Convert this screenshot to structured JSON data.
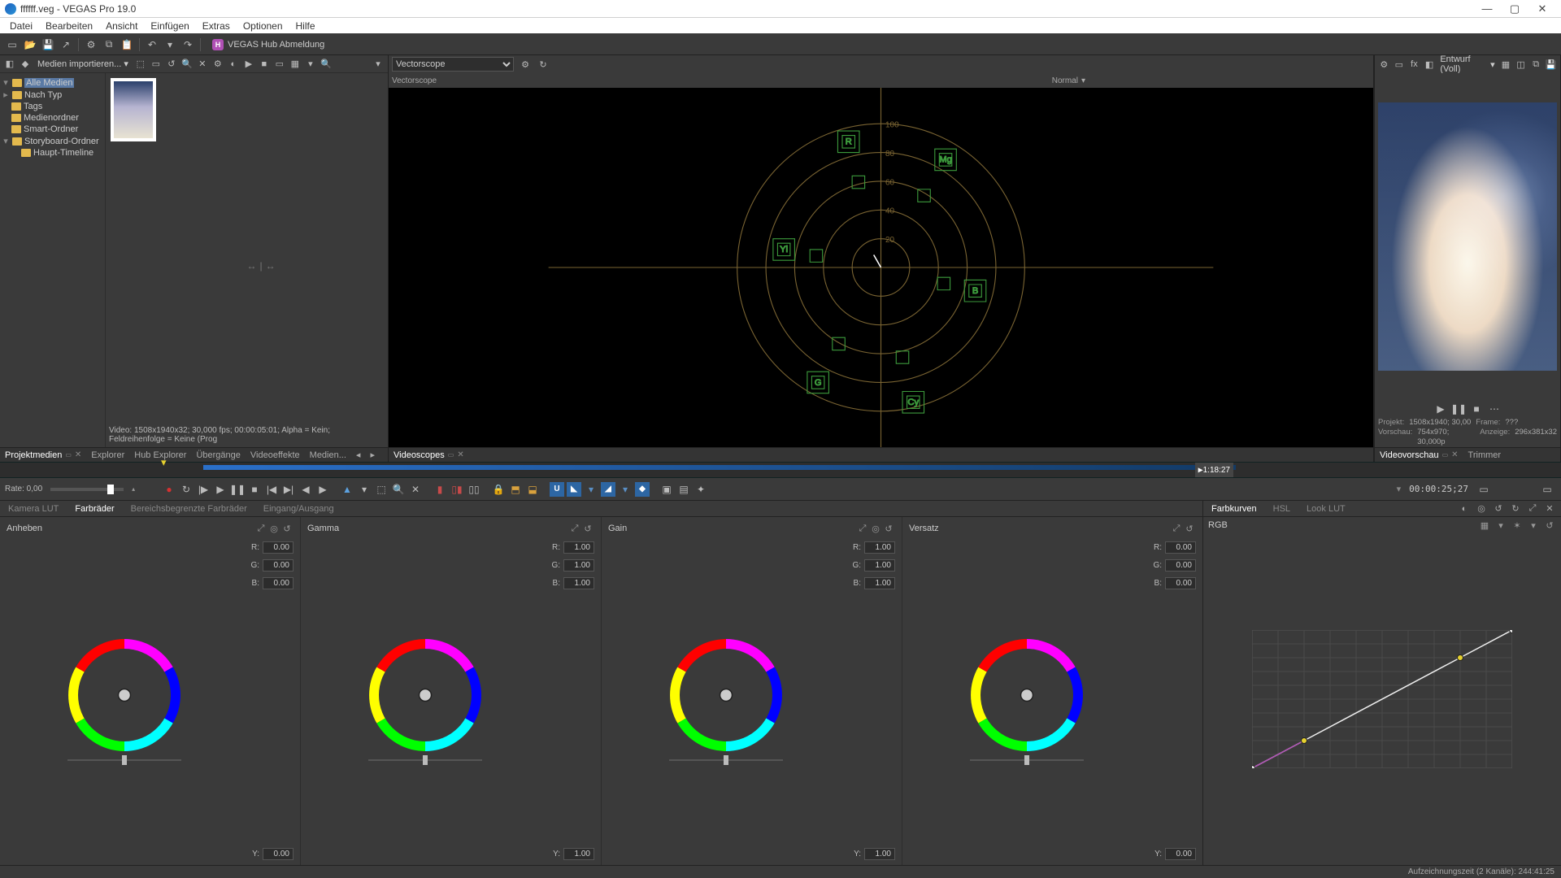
{
  "window": {
    "title": "ffffff.veg - VEGAS Pro 19.0"
  },
  "menu": [
    "Datei",
    "Bearbeiten",
    "Ansicht",
    "Einfügen",
    "Extras",
    "Optionen",
    "Hilfe"
  ],
  "hub": {
    "label": "VEGAS Hub Abmeldung",
    "letter": "H"
  },
  "mediaToolbar": {
    "import": "Medien importieren..."
  },
  "mediaTree": {
    "root": "Alle Medien",
    "items": [
      "Nach Typ",
      "Tags",
      "Medienordner",
      "Smart-Ordner",
      "Storyboard-Ordner"
    ],
    "sbChild": "Haupt-Timeline"
  },
  "mediaStatus": "Video: 1508x1940x32; 30,000 fps; 00:00:05:01; Alpha = Kein; Feldreihenfolge = Keine (Prog",
  "leftTabs": [
    "Projektmedien",
    "Explorer",
    "Hub Explorer",
    "Übergänge",
    "Videoeffekte",
    "Medien..."
  ],
  "scope": {
    "type": "Vectorscope",
    "mode": "Normal",
    "labels": {
      "r": "R",
      "mg": "Mg",
      "b": "B",
      "cy": "Cy",
      "g": "G",
      "yl": "Yl"
    },
    "rings": [
      "20",
      "40",
      "60",
      "80",
      "100"
    ]
  },
  "scopeTabs": [
    "Videoscopes"
  ],
  "preview": {
    "quality": "Entwurf (Voll)",
    "projLabel": "Projekt:",
    "proj": "1508x1940;  30,00",
    "frameLabel": "Frame:",
    "frame": "???",
    "prevLabel": "Vorschau:",
    "prev": "754x970;  30,000p",
    "dispLabel": "Anzeige:",
    "disp": "296x381x32"
  },
  "previewTabs": [
    "Videovorschau",
    "Trimmer"
  ],
  "timeline": {
    "tc": "1:18:27"
  },
  "transport": {
    "rateLabel": "Rate: 0,00",
    "tc": "00:00:25;27"
  },
  "gradeTabsLeft": [
    "Kamera LUT",
    "Farbräder",
    "Bereichsbegrenzte Farbräder",
    "Eingang/Ausgang"
  ],
  "gradeTabsRight": [
    "Farbkurven",
    "HSL",
    "Look LUT"
  ],
  "wheels": [
    {
      "title": "Anheben",
      "r": "0.00",
      "g": "0.00",
      "b": "0.00",
      "y": "0.00"
    },
    {
      "title": "Gamma",
      "r": "1.00",
      "g": "1.00",
      "b": "1.00",
      "y": "1.00"
    },
    {
      "title": "Gain",
      "r": "1.00",
      "g": "1.00",
      "b": "1.00",
      "y": "1.00"
    },
    {
      "title": "Versatz",
      "r": "0.00",
      "g": "0.00",
      "b": "0.00",
      "y": "0.00"
    }
  ],
  "wheelLabels": {
    "r": "R:",
    "g": "G:",
    "b": "B:",
    "y": "Y:"
  },
  "curves": {
    "title": "RGB"
  },
  "status": "Aufzeichnungszeit (2 Kanäle):  244:41:25"
}
